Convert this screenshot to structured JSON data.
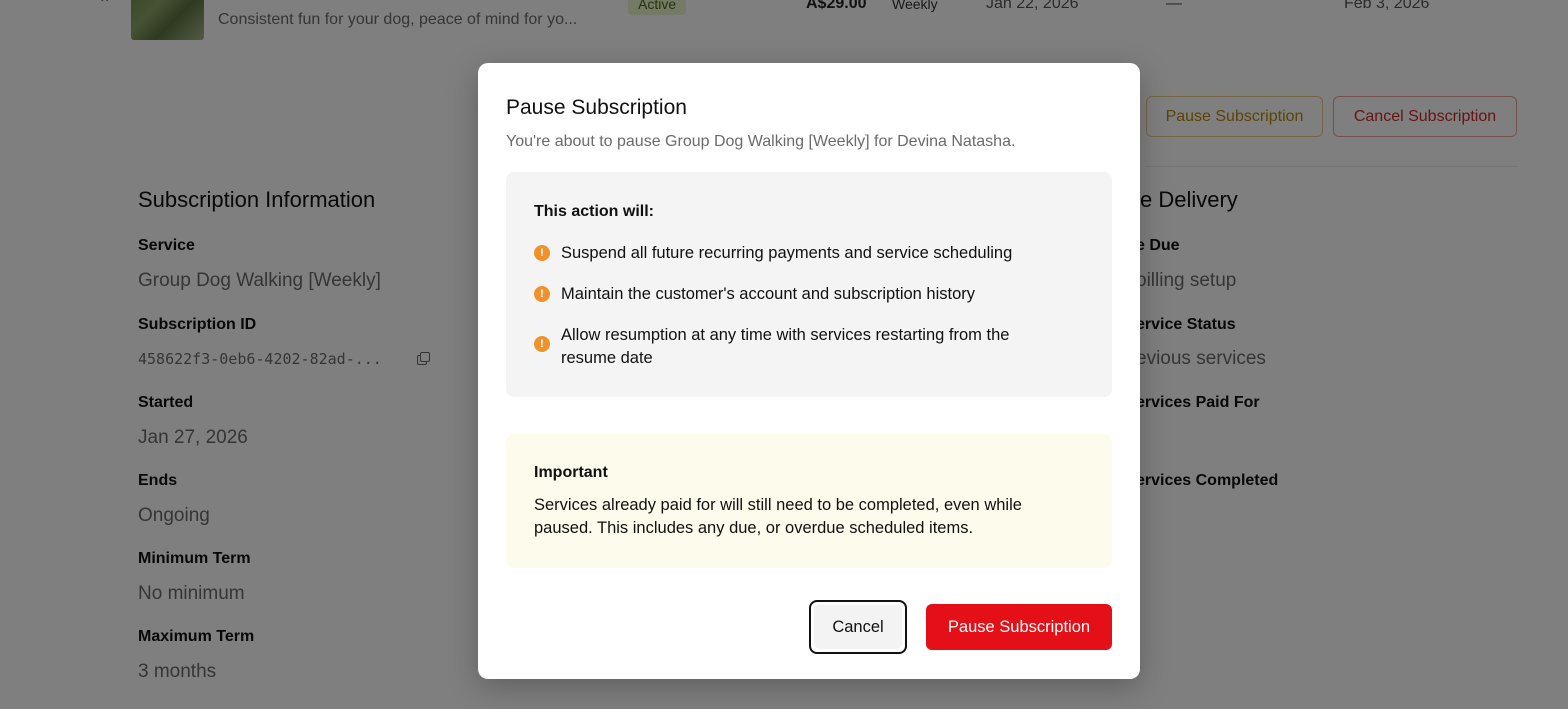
{
  "subscription_row": {
    "description": "Consistent fun for your dog, peace of mind for yo...",
    "status": "Active",
    "price": "A$29.00",
    "frequency": "Weekly",
    "start_date": "Jan 22, 2026",
    "end_date": "—",
    "next_date": "Feb 3, 2026"
  },
  "actions": {
    "pause_label": "Pause Subscription",
    "cancel_label": "Cancel Subscription"
  },
  "subscription_info": {
    "title": "Subscription Information",
    "service_label": "Service",
    "service_value": "Group Dog Walking [Weekly]",
    "id_label": "Subscription ID",
    "id_value": "458622f3-0eb6-4202-82ad-...",
    "started_label": "Started",
    "started_value": "Jan 27, 2026",
    "ends_label": "Ends",
    "ends_value": "Ongoing",
    "min_term_label": "Minimum Term",
    "min_term_value": "No minimum",
    "max_term_label": "Maximum Term",
    "max_term_value": "3 months"
  },
  "service_delivery": {
    "title": "ce Delivery",
    "due_label": "e Due",
    "due_value": "oilling setup",
    "status_label": "ervice Status",
    "status_value": "evious services",
    "paid_label": "ervices Paid For",
    "completed_label": "ervices Completed"
  },
  "modal": {
    "title": "Pause Subscription",
    "description": "You're about to pause Group Dog Walking [Weekly] for Devina Natasha.",
    "action_heading": "This action will:",
    "action_items": [
      "Suspend all future recurring payments and service scheduling",
      "Maintain the customer's account and subscription history",
      "Allow resumption at any time with services restarting from the resume date"
    ],
    "important_heading": "Important",
    "important_text": "Services already paid for will still need to be completed, even while paused. This includes any due, or overdue scheduled items.",
    "cancel_label": "Cancel",
    "confirm_label": "Pause Subscription"
  },
  "colors": {
    "confirm_button": "#e40f17",
    "warning_icon": "#f0922b",
    "important_bg": "#fdfbec"
  }
}
